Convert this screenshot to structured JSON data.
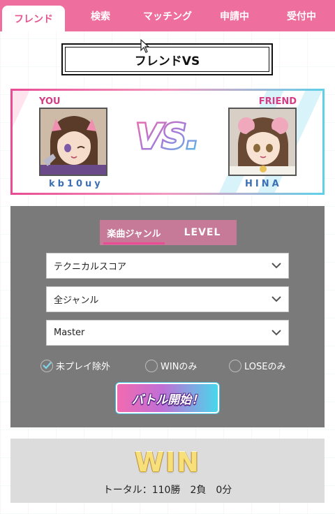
{
  "tabs": [
    {
      "label": "フレンド",
      "active": true
    },
    {
      "label": "検索",
      "active": false
    },
    {
      "label": "マッチング",
      "active": false
    },
    {
      "label": "申請中",
      "active": false
    },
    {
      "label": "受付中",
      "active": false
    }
  ],
  "page_title": "フレンドVS",
  "vs": {
    "you_label": "YOU",
    "friend_label": "FRIEND",
    "you_name": "kb10uy",
    "friend_name": "HINA",
    "logo_text": "VS."
  },
  "settings": {
    "subtabs": [
      {
        "label": "楽曲ジャンル",
        "active": true
      },
      {
        "label": "LEVEL",
        "active": false
      }
    ],
    "selects": [
      {
        "value": "テクニカルスコア"
      },
      {
        "value": "全ジャンル"
      },
      {
        "value": "Master"
      }
    ],
    "checks": [
      {
        "label": "未プレイ除外",
        "checked": true
      },
      {
        "label": "WINのみ",
        "checked": false
      },
      {
        "label": "LOSEのみ",
        "checked": false
      }
    ],
    "battle_button": "バトル開始！"
  },
  "result": {
    "status": "WIN",
    "record": "トータル：110勝　2負　0分"
  },
  "colors": {
    "tab_bar": "#ee6f9d",
    "active_tab_text": "#e6558f",
    "panel_gray": "#7a7a7a",
    "result_bg": "#dcdcdc"
  }
}
